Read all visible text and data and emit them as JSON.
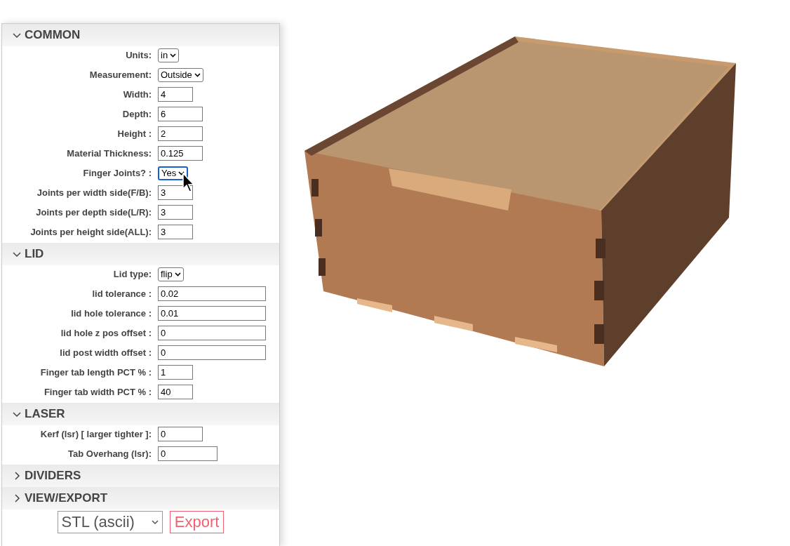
{
  "sections": [
    {
      "title": "COMMON",
      "expanded": true,
      "fields": [
        {
          "label": "Units:",
          "kind": "select",
          "value": "in",
          "focused": false
        },
        {
          "label": "Measurement:",
          "kind": "select",
          "value": "Outside",
          "focused": false
        },
        {
          "label": "Width:",
          "kind": "short",
          "value": "4"
        },
        {
          "label": "Depth:",
          "kind": "medium",
          "value": "6"
        },
        {
          "label": "Height :",
          "kind": "medium",
          "value": "2"
        },
        {
          "label": "Material Thickness:",
          "kind": "medium",
          "value": "0.125"
        },
        {
          "label": "Finger Joints? :",
          "kind": "select",
          "value": "Yes",
          "focused": true
        },
        {
          "label": "Joints per width side(F/B):",
          "kind": "short",
          "value": "3"
        },
        {
          "label": "Joints per depth side(L/R):",
          "kind": "short",
          "value": "3"
        },
        {
          "label": "Joints per height side(ALL):",
          "kind": "short",
          "value": "3"
        }
      ]
    },
    {
      "title": "LID",
      "expanded": true,
      "fields": [
        {
          "label": "Lid type:",
          "kind": "select",
          "value": "flip",
          "focused": false
        },
        {
          "label": "lid tolerance :",
          "kind": "long",
          "value": "0.02"
        },
        {
          "label": "lid hole tolerance :",
          "kind": "long",
          "value": "0.01"
        },
        {
          "label": "lid hole z pos offset :",
          "kind": "long",
          "value": "0"
        },
        {
          "label": "lid post width offset :",
          "kind": "long",
          "value": "0"
        },
        {
          "label": "Finger tab length PCT % :",
          "kind": "short",
          "value": "1"
        },
        {
          "label": "Finger tab width PCT % :",
          "kind": "short",
          "value": "40"
        }
      ]
    },
    {
      "title": "LASER",
      "expanded": true,
      "fields": [
        {
          "label": "Kerf (lsr) [ larger tighter ]:",
          "kind": "medium",
          "value": "0"
        },
        {
          "label": "Tab Overhang (lsr):",
          "kind": "wide",
          "value": "0"
        }
      ]
    },
    {
      "title": "DIVIDERS",
      "expanded": false
    },
    {
      "title": "VIEW/EXPORT",
      "expanded": false
    }
  ],
  "export": {
    "format": "STL (ascii)",
    "button": "Export"
  }
}
